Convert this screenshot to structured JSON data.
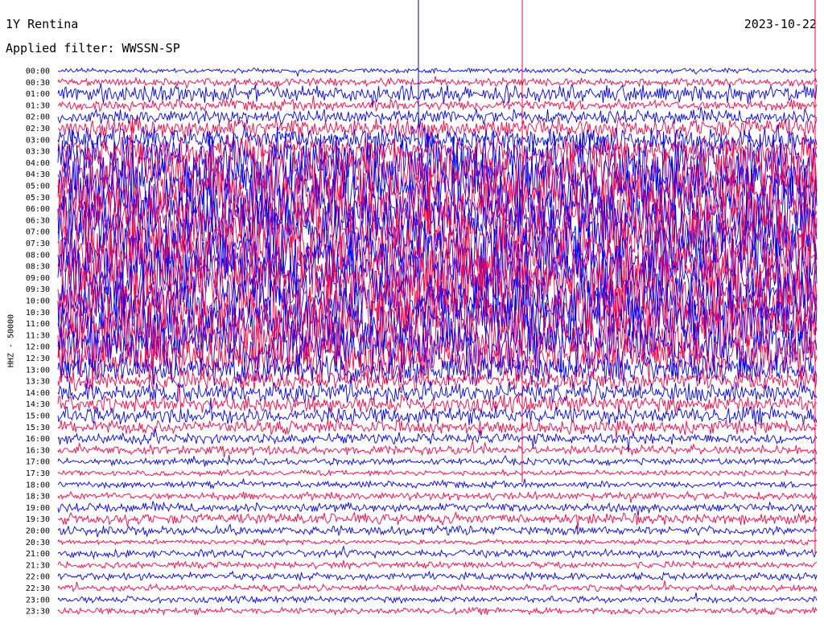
{
  "header": {
    "station": "1Y Rentina",
    "filter": "Applied filter: WWSSN-SP",
    "date": "2023-10-22"
  },
  "chart_data": {
    "type": "line",
    "title": "1Y Rentina",
    "subtitle": "Applied filter: WWSSN-SP",
    "ylabel": "HHZ - 50000",
    "xlabel": "",
    "grid": false,
    "row_labels": [
      "00:00",
      "00:30",
      "01:00",
      "01:30",
      "02:00",
      "02:30",
      "03:00",
      "03:30",
      "04:00",
      "04:30",
      "05:00",
      "05:30",
      "06:00",
      "06:30",
      "07:00",
      "07:30",
      "08:00",
      "08:30",
      "09:00",
      "09:30",
      "10:00",
      "10:30",
      "11:00",
      "11:30",
      "12:00",
      "12:30",
      "13:00",
      "13:30",
      "14:00",
      "14:30",
      "15:00",
      "15:30",
      "16:00",
      "16:30",
      "17:00",
      "17:30",
      "18:00",
      "18:30",
      "19:00",
      "19:30",
      "20:00",
      "20:30",
      "21:00",
      "21:30",
      "22:00",
      "22:30",
      "23:00",
      "23:30"
    ],
    "row_colors": [
      "#0000ff",
      "#ff0040"
    ],
    "amplitude_profile": [
      0.05,
      0.1,
      0.25,
      0.15,
      0.2,
      0.3,
      0.35,
      0.45,
      1.0,
      1.0,
      1.0,
      1.0,
      1.0,
      1.0,
      1.0,
      1.0,
      1.0,
      1.0,
      1.0,
      1.0,
      1.0,
      1.0,
      1.0,
      1.0,
      0.85,
      0.7,
      0.45,
      0.3,
      0.3,
      0.25,
      0.25,
      0.2,
      0.15,
      0.12,
      0.08,
      0.06,
      0.08,
      0.1,
      0.12,
      0.15,
      0.12,
      0.05,
      0.1,
      0.08,
      0.1,
      0.08,
      0.08,
      0.08
    ]
  }
}
